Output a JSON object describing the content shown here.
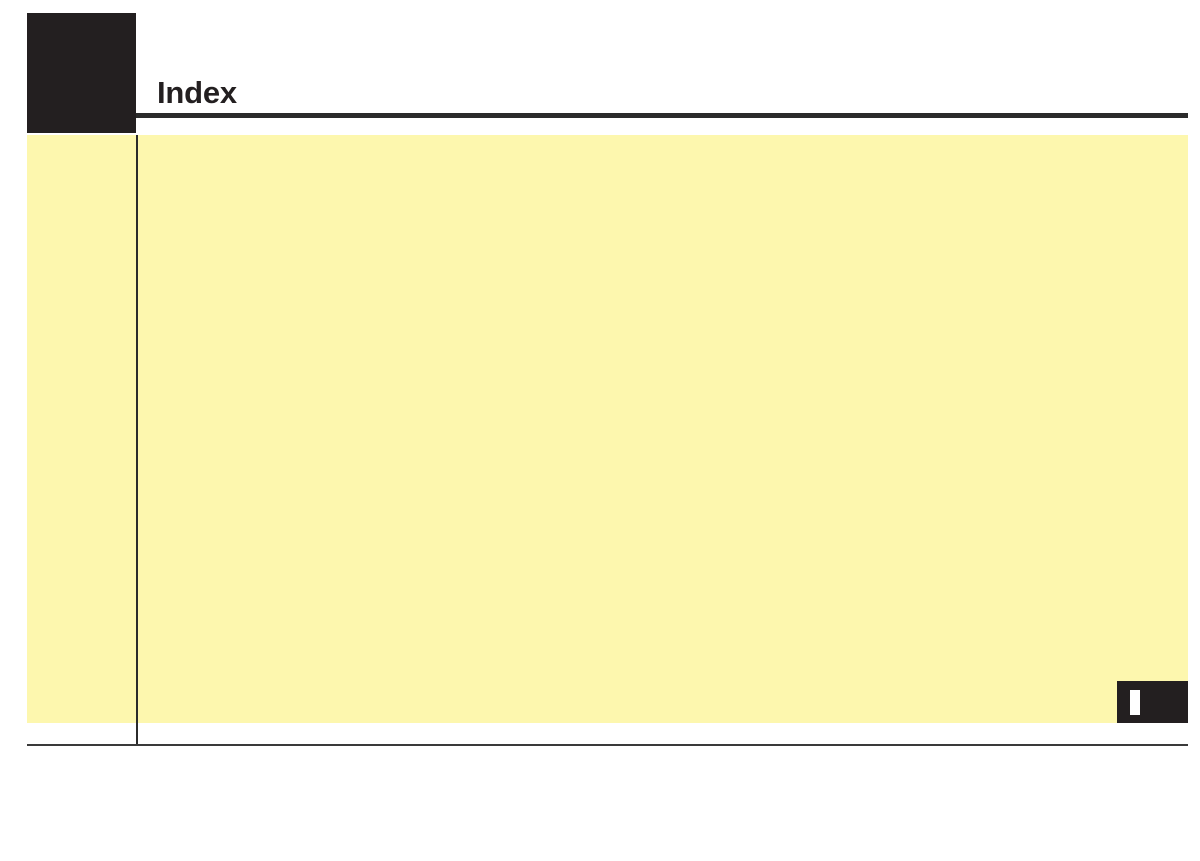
{
  "document": {
    "kind": "printed-manual-page",
    "page_background": "#ffffff"
  },
  "header": {
    "title": "Index",
    "section_marker": {
      "name": "section-block",
      "color": "#231f20",
      "label": ""
    },
    "rule": {
      "color": "#2b2b2b"
    }
  },
  "content": {
    "panel": {
      "background": "#fdf7ae",
      "body_text": ""
    },
    "divider": {
      "color": "#2b2b2b"
    },
    "columns": [
      {
        "name": "gutter-column",
        "text": ""
      },
      {
        "name": "index-body-column",
        "text": ""
      }
    ]
  },
  "edge_tab": {
    "letter": "I",
    "background": "#231f20",
    "letter_color": "#ffffff"
  },
  "footer": {
    "rule_color": "#3a3a3a",
    "page_number": ""
  },
  "colors": {
    "ink": "#231f20",
    "highlight": "#fdf7ae",
    "paper": "#ffffff",
    "rule": "#2b2b2b"
  }
}
